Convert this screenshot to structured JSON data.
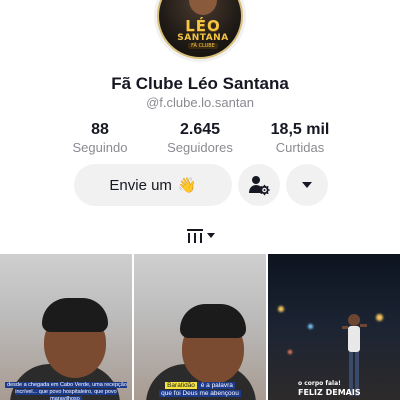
{
  "profile": {
    "avatar_logo": {
      "line1": "LÉO",
      "line2": "SANTANA",
      "line3": "FÃ CLUBE"
    },
    "name": "Fã Clube Léo Santana",
    "handle": "@f.clube.lo.santan"
  },
  "stats": [
    {
      "value": "88",
      "label": "Seguindo"
    },
    {
      "value": "2.645",
      "label": "Seguidores"
    },
    {
      "value": "18,5 mil",
      "label": "Curtidas"
    }
  ],
  "actions": {
    "message_label": "Envie um",
    "message_emoji": "👋",
    "add_friend_icon": "person-settings-icon",
    "dropdown_icon": "caret-down-icon"
  },
  "tabs": {
    "active_icon": "videos-grid-icon"
  },
  "videos": [
    {
      "caption": "desde a chegada em Cabo Verde, uma recepção incrível... que povo hospitaleiro, que povo maravilhoso"
    },
    {
      "caption_highlight": "Baratidão",
      "caption_rest": " é a palavra",
      "caption_line2": "que foi Deus me abençoou"
    },
    {
      "caption_small": "o corpo fala!",
      "caption_big": "FELIZ DEMAIS"
    }
  ],
  "colors": {
    "text_primary": "#161823",
    "text_secondary": "#8a8b91",
    "button_bg": "#f1f1f2",
    "caption_highlight": "#1e3a8a"
  }
}
